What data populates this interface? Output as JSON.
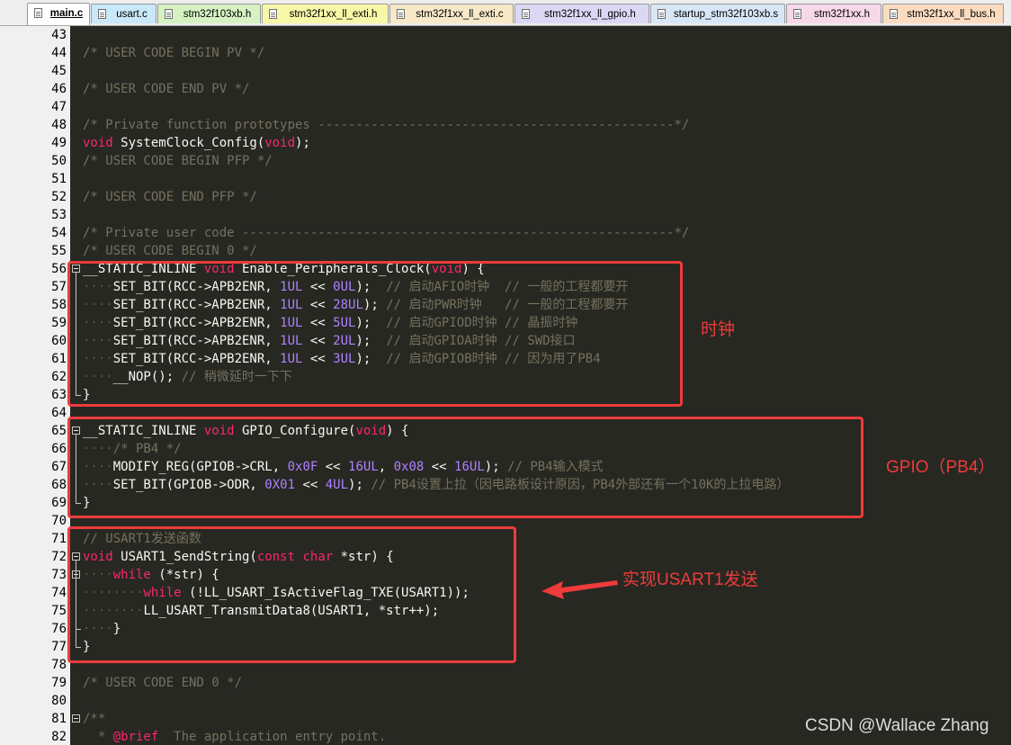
{
  "tabs": [
    {
      "label": "main.c",
      "active": true,
      "color": "#ffffff"
    },
    {
      "label": "usart.c",
      "active": false,
      "color": "#c9e8f8"
    },
    {
      "label": "stm32f103xb.h",
      "active": false,
      "color": "#d6f2c2"
    },
    {
      "label": "stm32f1xx_ll_exti.h",
      "active": false,
      "color": "#f8f7a8"
    },
    {
      "label": "stm32f1xx_ll_exti.c",
      "active": false,
      "color": "#f7e8c8"
    },
    {
      "label": "stm32f1xx_ll_gpio.h",
      "active": false,
      "color": "#dad8f4"
    },
    {
      "label": "startup_stm32f103xb.s",
      "active": false,
      "color": "#d8e7f7"
    },
    {
      "label": "stm32f1xx.h",
      "active": false,
      "color": "#f7d8e8"
    },
    {
      "label": "stm32f1xx_ll_bus.h",
      "active": false,
      "color": "#fbdcc0"
    }
  ],
  "code_lines": [
    {
      "n": "43",
      "tokens": []
    },
    {
      "n": "44",
      "tokens": [
        [
          "cm",
          "/* USER CODE BEGIN PV */"
        ]
      ]
    },
    {
      "n": "45",
      "tokens": []
    },
    {
      "n": "46",
      "tokens": [
        [
          "cm",
          "/* USER CODE END PV */"
        ]
      ]
    },
    {
      "n": "47",
      "tokens": []
    },
    {
      "n": "48",
      "tokens": [
        [
          "cm",
          "/* Private function prototypes -----------------------------------------------*/"
        ]
      ]
    },
    {
      "n": "49",
      "tokens": [
        [
          "kw",
          "void"
        ],
        [
          "",
          " SystemClock_Config("
        ],
        [
          "kw",
          "void"
        ],
        [
          "",
          ");"
        ]
      ]
    },
    {
      "n": "50",
      "tokens": [
        [
          "cm",
          "/* USER CODE BEGIN PFP */"
        ]
      ]
    },
    {
      "n": "51",
      "tokens": []
    },
    {
      "n": "52",
      "tokens": [
        [
          "cm",
          "/* USER CODE END PFP */"
        ]
      ]
    },
    {
      "n": "53",
      "tokens": []
    },
    {
      "n": "54",
      "tokens": [
        [
          "cm",
          "/* Private user code ---------------------------------------------------------*/"
        ]
      ]
    },
    {
      "n": "55",
      "tokens": [
        [
          "cm",
          "/* USER CODE BEGIN 0 */"
        ]
      ]
    },
    {
      "n": "56",
      "fold": true,
      "tokens": [
        [
          "",
          "__STATIC_INLINE "
        ],
        [
          "kw",
          "void"
        ],
        [
          "",
          " Enable_Peripherals_Clock("
        ],
        [
          "kw",
          "void"
        ],
        [
          "",
          ") {"
        ]
      ]
    },
    {
      "n": "57",
      "tokens": [
        [
          "ws",
          "····"
        ],
        [
          "",
          "SET_BIT(RCC->APB2ENR, "
        ],
        [
          "num",
          "1UL"
        ],
        [
          "",
          " << "
        ],
        [
          "num",
          "0UL"
        ],
        [
          "",
          ");  "
        ],
        [
          "cm",
          "// 启动AFIO时钟  // 一般的工程都要开"
        ]
      ]
    },
    {
      "n": "58",
      "tokens": [
        [
          "ws",
          "····"
        ],
        [
          "",
          "SET_BIT(RCC->APB2ENR, "
        ],
        [
          "num",
          "1UL"
        ],
        [
          "",
          " << "
        ],
        [
          "num",
          "28UL"
        ],
        [
          "",
          "); "
        ],
        [
          "cm",
          "// 启动PWR时钟   // 一般的工程都要开"
        ]
      ]
    },
    {
      "n": "59",
      "tokens": [
        [
          "ws",
          "····"
        ],
        [
          "",
          "SET_BIT(RCC->APB2ENR, "
        ],
        [
          "num",
          "1UL"
        ],
        [
          "",
          " << "
        ],
        [
          "num",
          "5UL"
        ],
        [
          "",
          ");  "
        ],
        [
          "cm",
          "// 启动GPIOD时钟 // 晶振时钟"
        ]
      ]
    },
    {
      "n": "60",
      "tokens": [
        [
          "ws",
          "····"
        ],
        [
          "",
          "SET_BIT(RCC->APB2ENR, "
        ],
        [
          "num",
          "1UL"
        ],
        [
          "",
          " << "
        ],
        [
          "num",
          "2UL"
        ],
        [
          "",
          ");  "
        ],
        [
          "cm",
          "// 启动GPIOA时钟 // SWD接口"
        ]
      ]
    },
    {
      "n": "61",
      "tokens": [
        [
          "ws",
          "····"
        ],
        [
          "",
          "SET_BIT(RCC->APB2ENR, "
        ],
        [
          "num",
          "1UL"
        ],
        [
          "",
          " << "
        ],
        [
          "num",
          "3UL"
        ],
        [
          "",
          ");  "
        ],
        [
          "cm",
          "// 启动GPIOB时钟 // 因为用了PB4"
        ]
      ]
    },
    {
      "n": "62",
      "tokens": [
        [
          "ws",
          "····"
        ],
        [
          "",
          "__NOP(); "
        ],
        [
          "cm",
          "// 稍微延时一下下"
        ]
      ]
    },
    {
      "n": "63",
      "foldend": true,
      "tokens": [
        [
          "",
          "}"
        ]
      ]
    },
    {
      "n": "64",
      "tokens": []
    },
    {
      "n": "65",
      "fold": true,
      "tokens": [
        [
          "",
          "__STATIC_INLINE "
        ],
        [
          "kw",
          "void"
        ],
        [
          "",
          " GPIO_Configure("
        ],
        [
          "kw",
          "void"
        ],
        [
          "",
          ") {"
        ]
      ]
    },
    {
      "n": "66",
      "tokens": [
        [
          "ws",
          "····"
        ],
        [
          "cm",
          "/* PB4 */"
        ]
      ]
    },
    {
      "n": "67",
      "tokens": [
        [
          "ws",
          "····"
        ],
        [
          "",
          "MODIFY_REG(GPIOB->CRL, "
        ],
        [
          "num",
          "0x0F"
        ],
        [
          "",
          " << "
        ],
        [
          "num",
          "16UL"
        ],
        [
          "",
          ", "
        ],
        [
          "num",
          "0x08"
        ],
        [
          "",
          " << "
        ],
        [
          "num",
          "16UL"
        ],
        [
          "",
          "); "
        ],
        [
          "cm",
          "// PB4输入模式"
        ]
      ]
    },
    {
      "n": "68",
      "tokens": [
        [
          "ws",
          "····"
        ],
        [
          "",
          "SET_BIT(GPIOB->ODR, "
        ],
        [
          "num",
          "0X01"
        ],
        [
          "",
          " << "
        ],
        [
          "num",
          "4UL"
        ],
        [
          "",
          "); "
        ],
        [
          "cm",
          "// PB4设置上拉（因电路板设计原因，PB4外部还有一个10K的上拉电路）"
        ]
      ]
    },
    {
      "n": "69",
      "foldend": true,
      "tokens": [
        [
          "",
          "}"
        ]
      ]
    },
    {
      "n": "70",
      "tokens": []
    },
    {
      "n": "71",
      "tokens": [
        [
          "cm",
          "// USART1发送函数"
        ]
      ]
    },
    {
      "n": "72",
      "fold": true,
      "tokens": [
        [
          "kw",
          "void"
        ],
        [
          "",
          " USART1_SendString("
        ],
        [
          "kw",
          "const"
        ],
        [
          "",
          " "
        ],
        [
          "kw",
          "char"
        ],
        [
          "",
          " *str) {"
        ]
      ]
    },
    {
      "n": "73",
      "fold": true,
      "tokens": [
        [
          "ws",
          "····"
        ],
        [
          "kw",
          "while"
        ],
        [
          "",
          " (*str) {"
        ]
      ]
    },
    {
      "n": "74",
      "tokens": [
        [
          "ws",
          "········"
        ],
        [
          "kw",
          "while"
        ],
        [
          "",
          " (!LL_USART_IsActiveFlag_TXE(USART1));"
        ]
      ]
    },
    {
      "n": "75",
      "tokens": [
        [
          "ws",
          "········"
        ],
        [
          "",
          "LL_USART_TransmitData8(USART1, *str++);"
        ]
      ]
    },
    {
      "n": "76",
      "foldend": true,
      "tokens": [
        [
          "ws",
          "····"
        ],
        [
          "",
          "}"
        ]
      ]
    },
    {
      "n": "77",
      "foldend": true,
      "tokens": [
        [
          "",
          "}"
        ]
      ]
    },
    {
      "n": "78",
      "tokens": []
    },
    {
      "n": "79",
      "tokens": [
        [
          "cm",
          "/* USER CODE END 0 */"
        ]
      ]
    },
    {
      "n": "80",
      "tokens": []
    },
    {
      "n": "81",
      "fold": true,
      "tokens": [
        [
          "cm",
          "/**"
        ]
      ]
    },
    {
      "n": "82",
      "tokens": [
        [
          "cm",
          "  * "
        ],
        [
          "kw",
          "@brief"
        ],
        [
          "cm",
          "  The application entry point."
        ]
      ]
    }
  ],
  "annotations": {
    "clock": "时钟",
    "gpio": "GPIO（PB4）",
    "usart": "实现USART1发送",
    "color": "#ee3b3b"
  },
  "watermark": "CSDN @Wallace Zhang"
}
